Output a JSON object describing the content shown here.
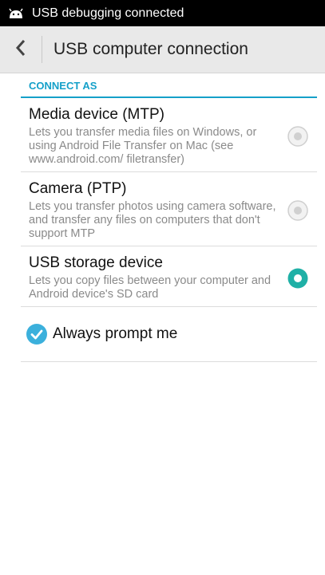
{
  "status_bar": {
    "notification_icon": "android-debug-icon",
    "text": "USB debugging connected"
  },
  "app_bar": {
    "back_icon": "chevron-left-icon",
    "title": "USB computer connection"
  },
  "section": {
    "header": "CONNECT AS",
    "options": [
      {
        "title": "Media device (MTP)",
        "description": "Lets you transfer media files on Windows, or using Android File Transfer on Mac (see www.android.com/ filetransfer)",
        "selected": false
      },
      {
        "title": "Camera (PTP)",
        "description": "Lets you transfer photos using camera software, and transfer any files on computers that don't support MTP",
        "selected": false
      },
      {
        "title": "USB storage device",
        "description": "Lets you copy files between your computer and Android device's SD card",
        "selected": true
      }
    ]
  },
  "always_prompt": {
    "label": "Always prompt me",
    "checked": true
  },
  "colors": {
    "accent": "#15a0c9",
    "selected_radio": "#1fb0a6",
    "appbar_bg": "#e9e9e9"
  }
}
